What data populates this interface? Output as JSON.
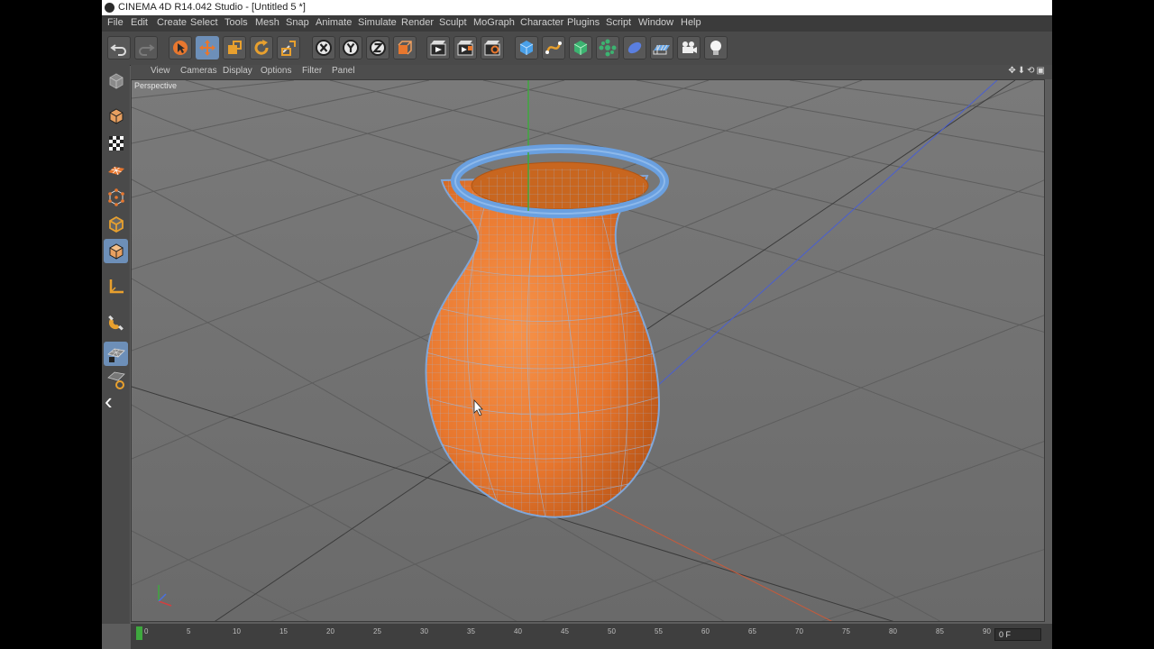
{
  "window": {
    "title": "CINEMA 4D R14.042 Studio - [Untitled 5 *]"
  },
  "menu": [
    "File",
    "Edit",
    "Create",
    "Select",
    "Tools",
    "Mesh",
    "Snap",
    "Animate",
    "Simulate",
    "Render",
    "Sculpt",
    "MoGraph",
    "Character",
    "Plugins",
    "Script",
    "Window",
    "Help"
  ],
  "viewport_menu": [
    "View",
    "Cameras",
    "Display",
    "Options",
    "Filter",
    "Panel"
  ],
  "viewport": {
    "label": "Perspective"
  },
  "timeline": {
    "ticks": [
      "0",
      "5",
      "10",
      "15",
      "20",
      "25",
      "30",
      "35",
      "40",
      "45",
      "50",
      "55",
      "60",
      "65",
      "70",
      "75",
      "80",
      "85",
      "90"
    ],
    "current_frame": "0 F"
  },
  "colors": {
    "accent": "#6d8fb8",
    "object": "#e8772e",
    "selection": "#6aa0e0"
  },
  "icons": {
    "toolbar": [
      "undo-icon",
      "redo-icon",
      "live-selection-icon",
      "move-icon",
      "scale-icon",
      "rotate-icon",
      "recent-tools-icon",
      "x-axis-lock-icon",
      "y-axis-lock-icon",
      "z-axis-lock-icon",
      "coordinate-system-icon",
      "render-view-icon",
      "render-picture-viewer-icon",
      "edit-render-settings-icon",
      "cube-primitive-icon",
      "spline-icon",
      "nurbs-icon",
      "array-icon",
      "deformer-icon",
      "floor-icon",
      "camera-icon",
      "light-icon"
    ],
    "leftbar": [
      "make-editable-icon",
      "model-mode-icon",
      "texture-mode-icon",
      "workplane-mode-icon",
      "points-mode-icon",
      "edges-mode-icon",
      "polygons-mode-icon",
      "axis-mode-icon",
      "snapping-icon",
      "workplane-lock-icon",
      "soft-selection-icon"
    ]
  }
}
